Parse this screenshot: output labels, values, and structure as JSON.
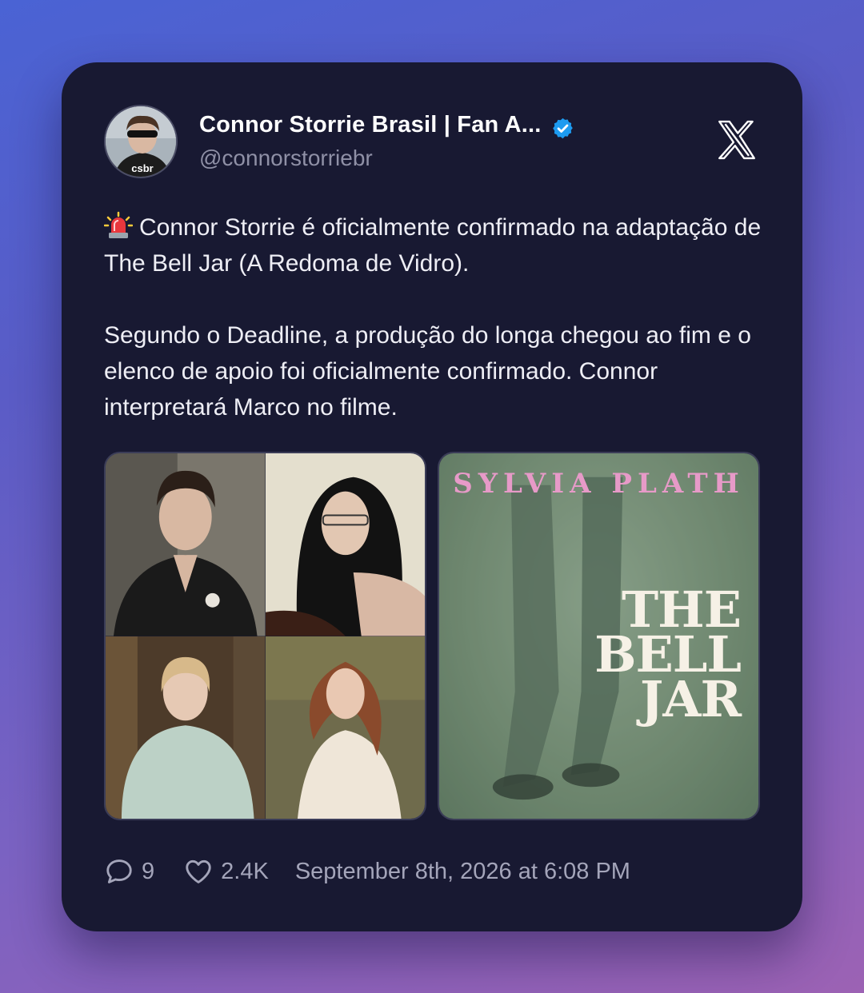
{
  "author": {
    "display_name": "Connor Storrie Brasil | Fan A...",
    "handle": "@connorstorriebr",
    "avatar_text": "csbr",
    "verified": true
  },
  "tweet": {
    "paragraph_1": "Connor Storrie é oficialmente confirmado na adaptação de The Bell Jar (A Redoma de Vidro).",
    "paragraph_2": "Segundo o Deadline, a produção do longa chegou ao fim e o elenco de apoio foi oficialmente confirmado. Connor interpretará Marco no filme.",
    "emoji": "rotating-light"
  },
  "media": {
    "book_cover": {
      "author": "SYLVIA PLATH",
      "title_lines": [
        "THE",
        "BELL",
        "JAR"
      ]
    }
  },
  "footer": {
    "replies": "9",
    "likes": "2.4K",
    "timestamp": "September 8th, 2026 at 6:08 PM"
  },
  "colors": {
    "card_bg": "#181932",
    "verified_blue": "#1d9bf0",
    "cover_green": "#6e876f",
    "cover_author_pink": "#e79ac8"
  }
}
